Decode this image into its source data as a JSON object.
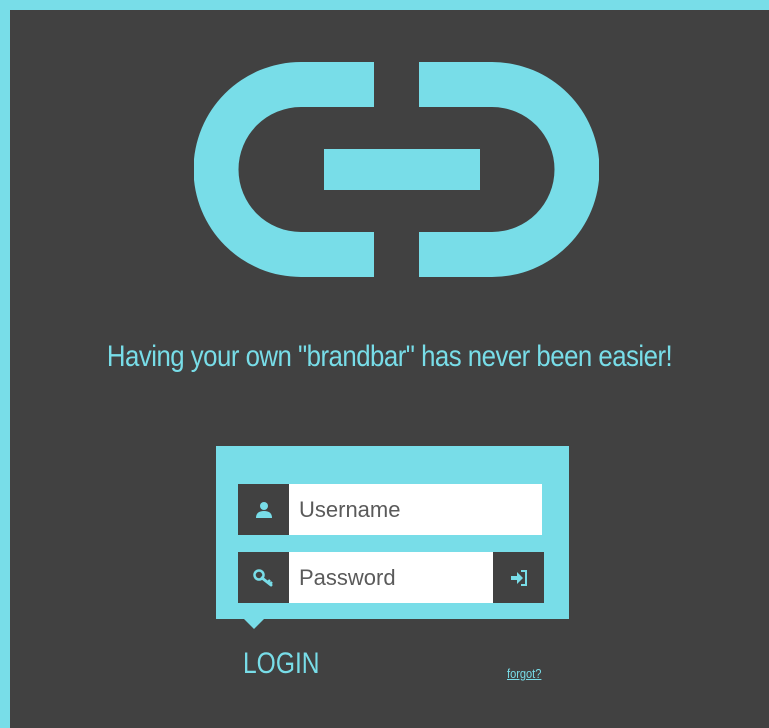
{
  "colors": {
    "accent": "#78DDE8",
    "background": "#414141",
    "input_background": "#FFFFFF"
  },
  "logo": {
    "icon": "link-chain-logo"
  },
  "tagline": "Having your own \"brandbar\" has never been easier!",
  "login_form": {
    "username": {
      "icon": "user-icon",
      "placeholder": "Username",
      "value": ""
    },
    "password": {
      "icon": "key-icon",
      "placeholder": "Password",
      "value": ""
    },
    "submit": {
      "icon": "sign-in-icon"
    }
  },
  "login_label": "LOGIN",
  "forgot_link": "forgot?"
}
